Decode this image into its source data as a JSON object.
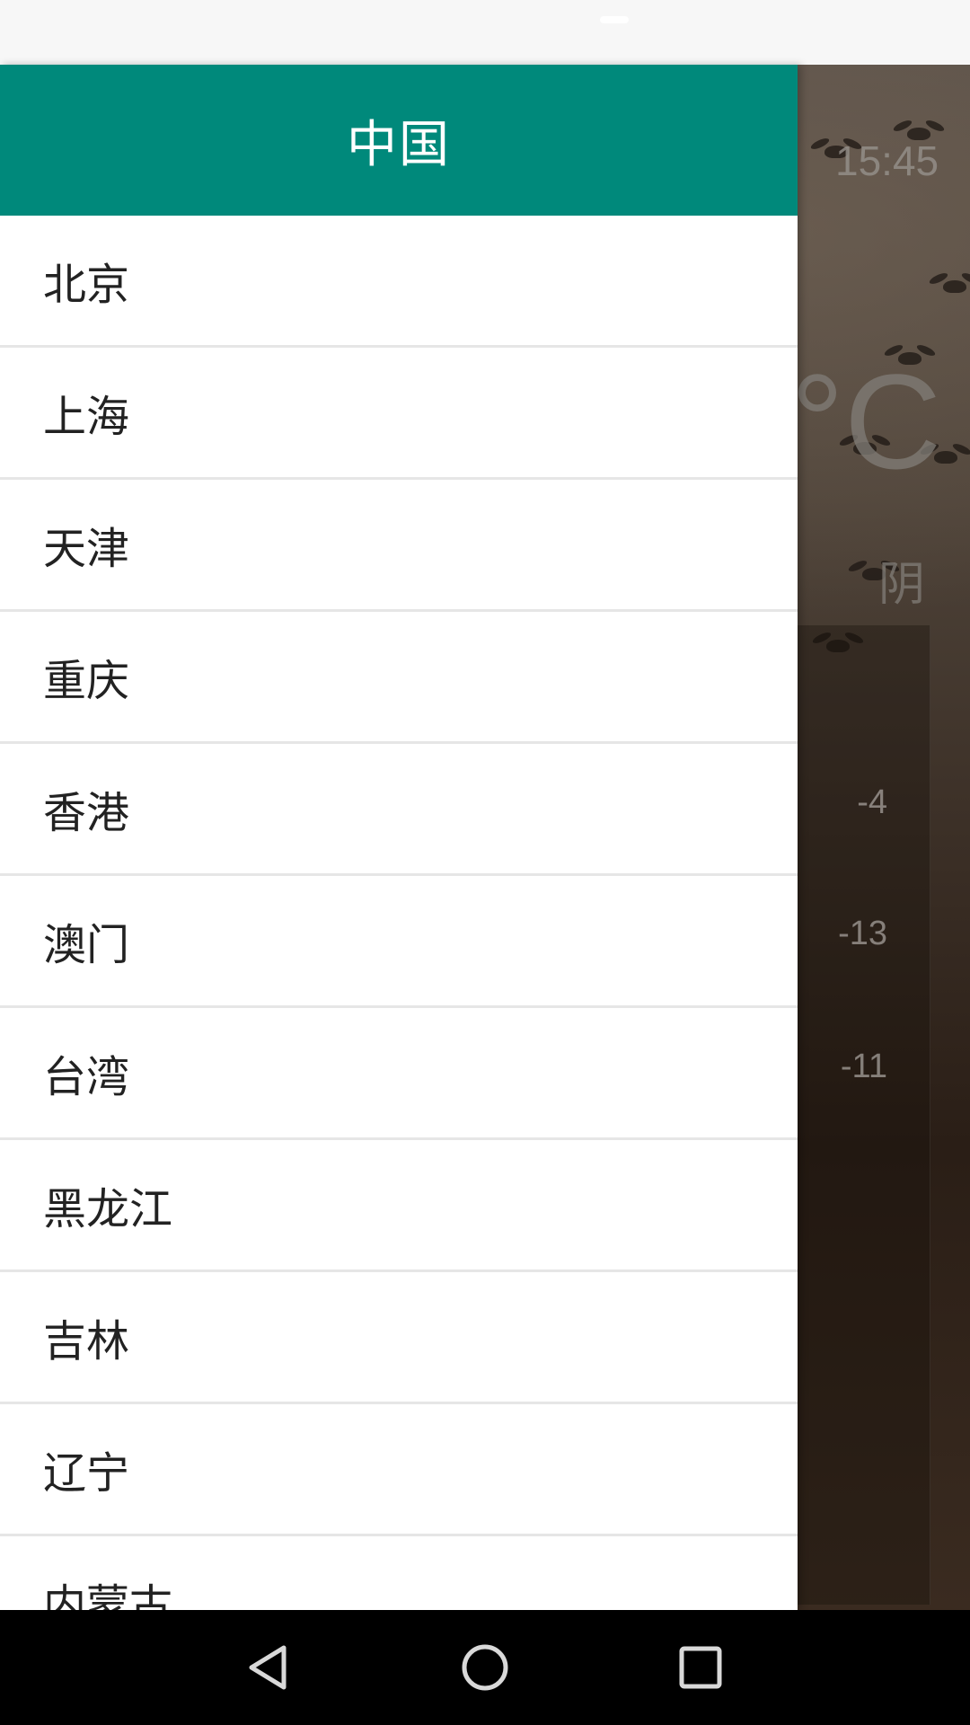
{
  "drawer": {
    "title": "中国",
    "cities": [
      "北京",
      "上海",
      "天津",
      "重庆",
      "香港",
      "澳门",
      "台湾",
      "黑龙江",
      "吉林",
      "辽宁",
      "内蒙古"
    ]
  },
  "weather": {
    "time": "15:45",
    "temp_unit": "°C",
    "description": "阴",
    "forecast_values": [
      "-4",
      "-13",
      "-11"
    ]
  },
  "nav": {
    "back_icon": "back-triangle-icon",
    "home_icon": "home-circle-icon",
    "recents_icon": "recents-square-icon"
  },
  "colors": {
    "header": "#00897b",
    "drawer_bg": "#ffffff",
    "divider": "#e6e6e6",
    "nav_bar": "#000000"
  }
}
